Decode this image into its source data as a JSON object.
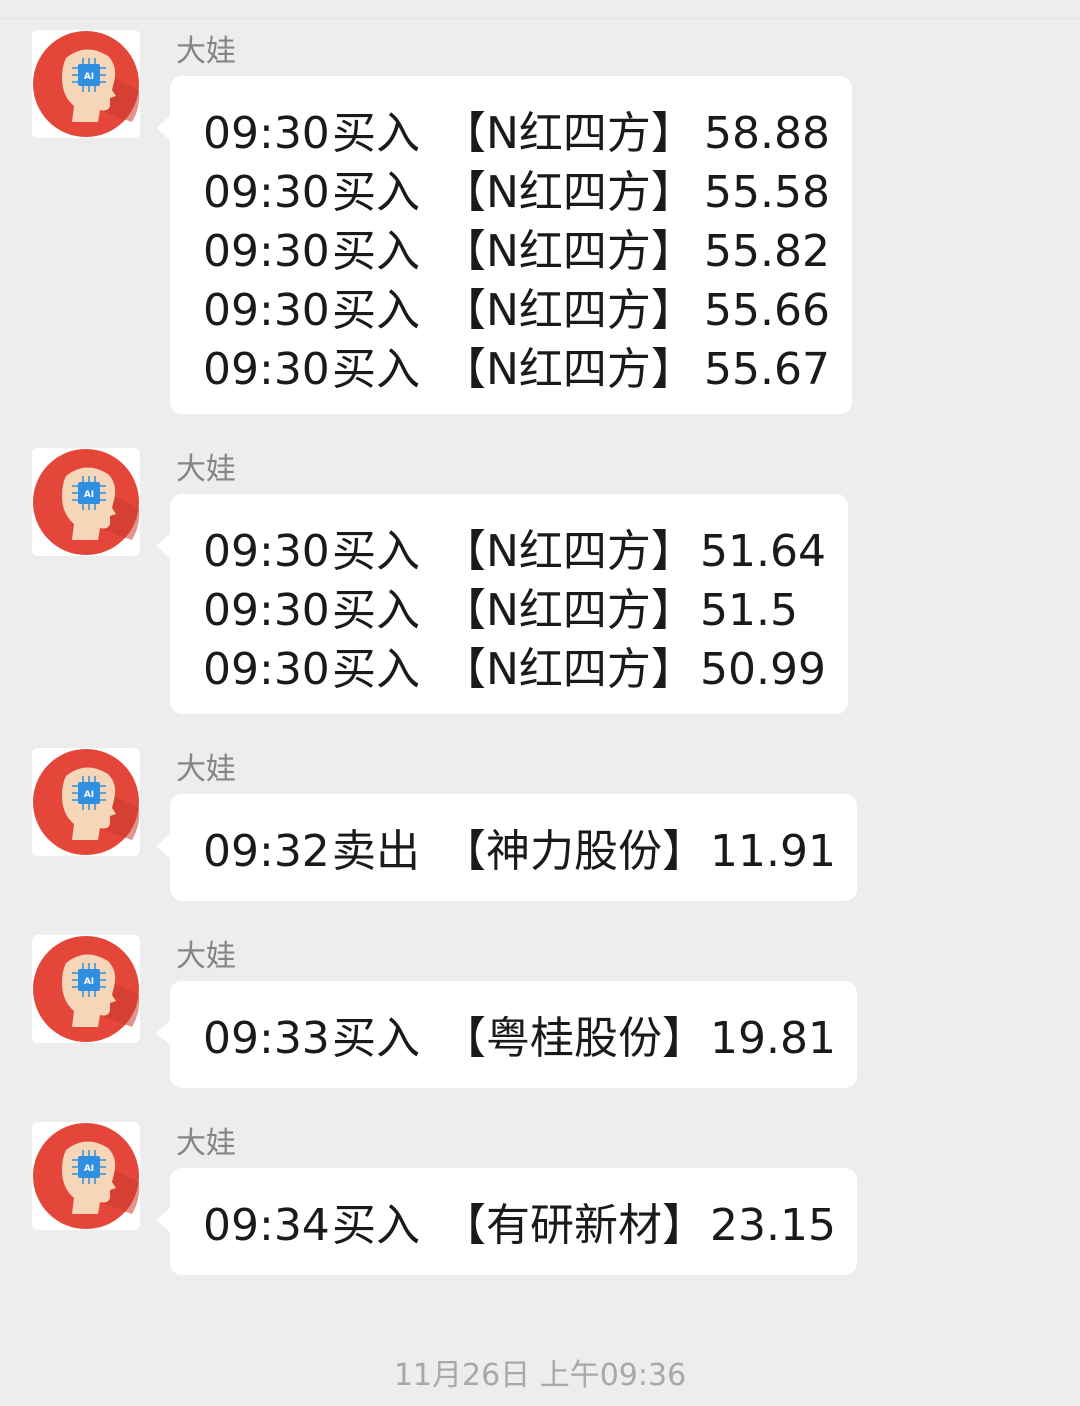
{
  "colors": {
    "background": "#ededed",
    "bubble": "#ffffff",
    "avatar_red": "#e4473a",
    "avatar_chip": "#2f8fe0",
    "sender_name": "#858585",
    "timestamp": "#a8a8a8"
  },
  "avatar": {
    "icon": "ai-head-avatar-icon",
    "chip_label": "AI"
  },
  "messages": [
    {
      "sender": "大娃",
      "lines": [
        {
          "time": "09:30",
          "action": "买入",
          "stock": "【N红四方】",
          "price": "58.88"
        },
        {
          "time": "09:30",
          "action": "买入",
          "stock": "【N红四方】",
          "price": "55.58"
        },
        {
          "time": "09:30",
          "action": "买入",
          "stock": "【N红四方】",
          "price": "55.82"
        },
        {
          "time": "09:30",
          "action": "买入",
          "stock": "【N红四方】",
          "price": "55.66"
        },
        {
          "time": "09:30",
          "action": "买入",
          "stock": "【N红四方】",
          "price": "55.67"
        }
      ]
    },
    {
      "sender": "大娃",
      "lines": [
        {
          "time": "09:30",
          "action": "买入",
          "stock": "【N红四方】",
          "price": "51.64"
        },
        {
          "time": "09:30",
          "action": "买入",
          "stock": "【N红四方】",
          "price": "51.5"
        },
        {
          "time": "09:30",
          "action": "买入",
          "stock": "【N红四方】",
          "price": "50.99"
        }
      ]
    },
    {
      "sender": "大娃",
      "lines": [
        {
          "time": "09:32",
          "action": "卖出",
          "stock": "【神力股份】",
          "price": "11.91"
        }
      ]
    },
    {
      "sender": "大娃",
      "lines": [
        {
          "time": "09:33",
          "action": "买入",
          "stock": "【粤桂股份】",
          "price": "19.81"
        }
      ]
    },
    {
      "sender": "大娃",
      "lines": [
        {
          "time": "09:34",
          "action": "买入",
          "stock": "【有研新材】",
          "price": "23.15"
        }
      ]
    }
  ],
  "timestamp": "11月26日 上午09:36"
}
